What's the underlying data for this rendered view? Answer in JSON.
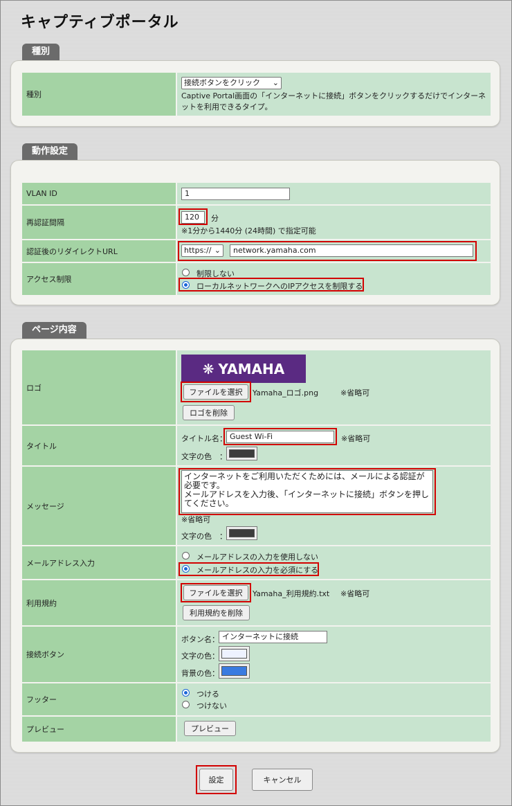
{
  "page": {
    "title": "キャプティブポータル"
  },
  "sections": {
    "type": "種別",
    "behavior": "動作設定",
    "content": "ページ内容"
  },
  "type_row": {
    "label": "種別",
    "selected": "接続ボタンをクリック",
    "description": "Captive Portal画面の「インターネットに接続」ボタンをクリックするだけでインターネットを利用できるタイプ。"
  },
  "vlan": {
    "label": "VLAN ID",
    "value": "1"
  },
  "reauth": {
    "label": "再認証間隔",
    "value": "120",
    "unit": "分",
    "note": "※1分から1440分 (24時間) で指定可能"
  },
  "redirect": {
    "label": "認証後のリダイレクトURL",
    "scheme": "https://",
    "url": "network.yamaha.com"
  },
  "access": {
    "label": "アクセス制限",
    "opt1": "制限しない",
    "opt2": "ローカルネットワークへのIPアクセスを制限する"
  },
  "logo": {
    "label": "ロゴ",
    "image_text": "YAMAHA",
    "file_button": "ファイルを選択",
    "filename": "Yamaha_ロゴ.png",
    "optional": "※省略可",
    "delete_button": "ロゴを削除"
  },
  "title_row": {
    "label": "タイトル",
    "name_label": "タイトル名：",
    "value": "Guest Wi-Fi",
    "optional": "※省略可",
    "color_label": "文字の色　：",
    "color": "#3c3c3c"
  },
  "message": {
    "label": "メッセージ",
    "text": "インターネットをご利用いただくためには、メールによる認証が必要です。\nメールアドレスを入力後、「インターネットに接続」ボタンを押してください。",
    "optional": "※省略可",
    "color_label": "文字の色　：",
    "color": "#3c3c3c"
  },
  "email": {
    "label": "メールアドレス入力",
    "opt1": "メールアドレスの入力を使用しない",
    "opt2": "メールアドレスの入力を必須にする"
  },
  "terms": {
    "label": "利用規約",
    "file_button": "ファイルを選択",
    "filename": "Yamaha_利用規約.txt",
    "optional": "※省略可",
    "delete_button": "利用規約を削除"
  },
  "connect_button": {
    "label": "接続ボタン",
    "name_label": "ボタン名：",
    "value": "インターネットに接続",
    "text_color_label": "文字の色：",
    "text_color": "#eef2ff",
    "bg_color_label": "背景の色：",
    "bg_color": "#3a7be0"
  },
  "footer": {
    "label": "フッター",
    "opt1": "つける",
    "opt2": "つけない"
  },
  "preview": {
    "label": "プレビュー",
    "button": "プレビュー"
  },
  "actions": {
    "save": "設定",
    "cancel": "キャンセル"
  }
}
